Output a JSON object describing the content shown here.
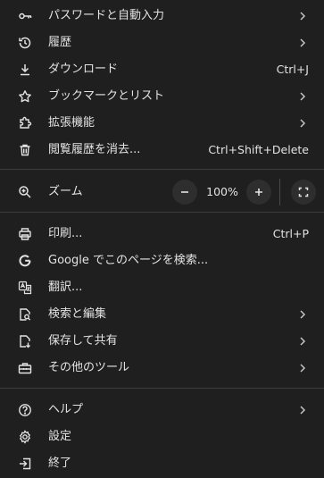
{
  "menu": {
    "items": [
      {
        "label": "パスワードと自動入力",
        "icon": "key-icon",
        "submenu": true
      },
      {
        "label": "履歴",
        "icon": "history-icon",
        "submenu": true
      },
      {
        "label": "ダウンロード",
        "icon": "download-icon",
        "shortcut": "Ctrl+J"
      },
      {
        "label": "ブックマークとリスト",
        "icon": "star-icon",
        "submenu": true
      },
      {
        "label": "拡張機能",
        "icon": "puzzle-icon",
        "submenu": true
      },
      {
        "label": "閲覧履歴を消去...",
        "icon": "trash-icon",
        "shortcut": "Ctrl+Shift+Delete"
      }
    ],
    "zoom": {
      "label": "ズーム",
      "icon": "zoom-icon",
      "value": "100%",
      "decrease": "−",
      "increase": "+"
    },
    "items2": [
      {
        "label": "印刷...",
        "icon": "print-icon",
        "shortcut": "Ctrl+P"
      },
      {
        "label": "Google でこのページを検索...",
        "icon": "google-icon"
      },
      {
        "label": "翻訳...",
        "icon": "translate-icon"
      },
      {
        "label": "検索と編集",
        "icon": "find-icon",
        "submenu": true
      },
      {
        "label": "保存して共有",
        "icon": "save-share-icon",
        "submenu": true
      },
      {
        "label": "その他のツール",
        "icon": "toolbox-icon",
        "submenu": true
      }
    ],
    "items3": [
      {
        "label": "ヘルプ",
        "icon": "help-icon",
        "submenu": true
      },
      {
        "label": "設定",
        "icon": "settings-icon"
      },
      {
        "label": "終了",
        "icon": "exit-icon"
      }
    ]
  },
  "colors": {
    "background": "#1f1f1f",
    "text": "#e3e3e3",
    "divider": "#3c3c3c",
    "button": "#2e2e2e"
  }
}
